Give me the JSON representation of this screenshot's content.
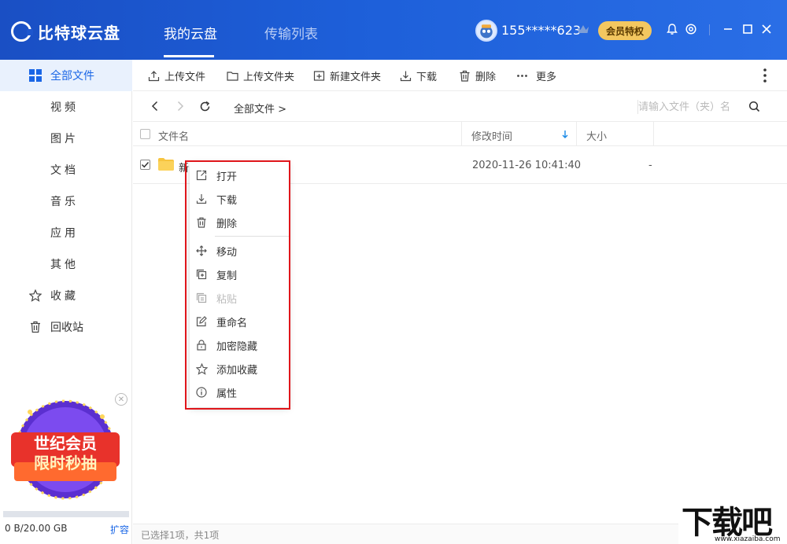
{
  "app": {
    "logo_text": "比特球云盘",
    "tabs": [
      {
        "label": "我的云盘",
        "active": true
      },
      {
        "label": "传输列表",
        "active": false
      }
    ],
    "user_id": "155*****623",
    "vip_button": "会员特权",
    "accent_color": "#1a66e6",
    "header_color": "#1d5fd9"
  },
  "sidebar": {
    "items": [
      {
        "label": "全部文件",
        "icon": "grid-icon",
        "active": true
      },
      {
        "label": "视频"
      },
      {
        "label": "图片"
      },
      {
        "label": "文档"
      },
      {
        "label": "音乐"
      },
      {
        "label": "应用"
      },
      {
        "label": "其他"
      },
      {
        "label": "收藏",
        "icon": "star-icon"
      },
      {
        "label": "回收站",
        "icon": "trash-icon"
      }
    ],
    "promo_text_1": "世纪会员",
    "promo_text_2": "限时秒抽",
    "storage": "0 B/20.00 GB",
    "storage_used_fraction": 0,
    "expand": "扩容"
  },
  "toolbar": {
    "upload_file": "上传文件",
    "upload_folder": "上传文件夹",
    "new_folder": "新建文件夹",
    "download": "下载",
    "delete": "删除",
    "more": "更多"
  },
  "pathbar": {
    "crumb": "全部文件 >",
    "search_placeholder": "请输入文件（夹）名"
  },
  "table": {
    "col_name": "文件名",
    "col_modified": "修改时间",
    "col_size": "大小",
    "rows": [
      {
        "name": "新",
        "modified": "2020-11-26 10:41:40",
        "size": "-",
        "checked": true
      }
    ]
  },
  "context_menu": {
    "items": [
      {
        "label": "打开",
        "icon": "open-external-icon"
      },
      {
        "label": "下载",
        "icon": "download-icon"
      },
      {
        "label": "删除",
        "icon": "trash-icon"
      },
      {
        "label": "移动",
        "icon": "move-icon"
      },
      {
        "label": "复制",
        "icon": "copy-icon"
      },
      {
        "label": "粘贴",
        "icon": "paste-icon",
        "disabled": true
      },
      {
        "label": "重命名",
        "icon": "rename-icon"
      },
      {
        "label": "加密隐藏",
        "icon": "lock-icon"
      },
      {
        "label": "添加收藏",
        "icon": "star-icon"
      },
      {
        "label": "属性",
        "icon": "info-icon"
      }
    ]
  },
  "status": "已选择1项，共1项",
  "watermark": {
    "big": "下载吧",
    "url": "www.xiazaiba.com"
  }
}
